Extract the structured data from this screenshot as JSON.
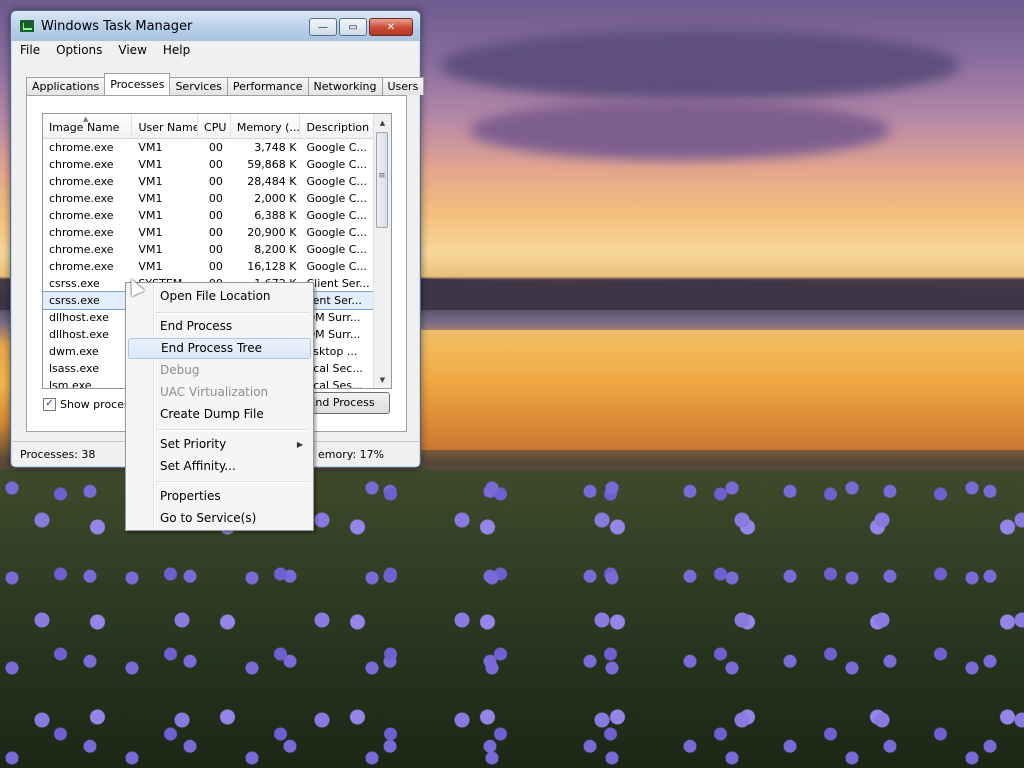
{
  "window": {
    "title": "Windows Task Manager",
    "min": "—",
    "max": "▭",
    "close": "✕"
  },
  "menu": [
    "File",
    "Options",
    "View",
    "Help"
  ],
  "tabs": [
    "Applications",
    "Processes",
    "Services",
    "Performance",
    "Networking",
    "Users"
  ],
  "columns": [
    "Image Name",
    "User Name",
    "CPU",
    "Memory (...",
    "Description"
  ],
  "rows": [
    [
      "chrome.exe",
      "VM1",
      "00",
      "3,748 K",
      "Google C..."
    ],
    [
      "chrome.exe",
      "VM1",
      "00",
      "59,868 K",
      "Google C..."
    ],
    [
      "chrome.exe",
      "VM1",
      "00",
      "28,484 K",
      "Google C..."
    ],
    [
      "chrome.exe",
      "VM1",
      "00",
      "2,000 K",
      "Google C..."
    ],
    [
      "chrome.exe",
      "VM1",
      "00",
      "6,388 K",
      "Google C..."
    ],
    [
      "chrome.exe",
      "VM1",
      "00",
      "20,900 K",
      "Google C..."
    ],
    [
      "chrome.exe",
      "VM1",
      "00",
      "8,200 K",
      "Google C..."
    ],
    [
      "chrome.exe",
      "VM1",
      "00",
      "16,128 K",
      "Google C..."
    ],
    [
      "csrss.exe",
      "SYSTEM",
      "00",
      "1,672 K",
      "Client Ser..."
    ],
    [
      "csrss.exe",
      "",
      "",
      "",
      "lient Ser..."
    ],
    [
      "dllhost.exe",
      "",
      "",
      "",
      "OM Surr..."
    ],
    [
      "dllhost.exe",
      "",
      "",
      "",
      "OM Surr..."
    ],
    [
      "dwm.exe",
      "",
      "",
      "",
      "esktop ..."
    ],
    [
      "lsass.exe",
      "",
      "",
      "",
      "ocal Sec..."
    ],
    [
      "lsm.exe",
      "",
      "",
      "",
      "ocal Ses..."
    ]
  ],
  "selected_row": 9,
  "checkbox": {
    "label": "Show processe",
    "checked": true
  },
  "end_button": "End Process",
  "status": {
    "processes": "Processes: 38",
    "memory": "emory: 17%"
  },
  "context_menu": {
    "items": [
      {
        "label": "Open File Location"
      },
      {
        "label": "End Process"
      },
      {
        "label": "End Process Tree"
      },
      {
        "label": "Debug"
      },
      {
        "label": "UAC Virtualization"
      },
      {
        "label": "Create Dump File"
      },
      {
        "label": "Set Priority"
      },
      {
        "label": "Set Affinity..."
      },
      {
        "label": "Properties"
      },
      {
        "label": "Go to Service(s)"
      }
    ]
  }
}
